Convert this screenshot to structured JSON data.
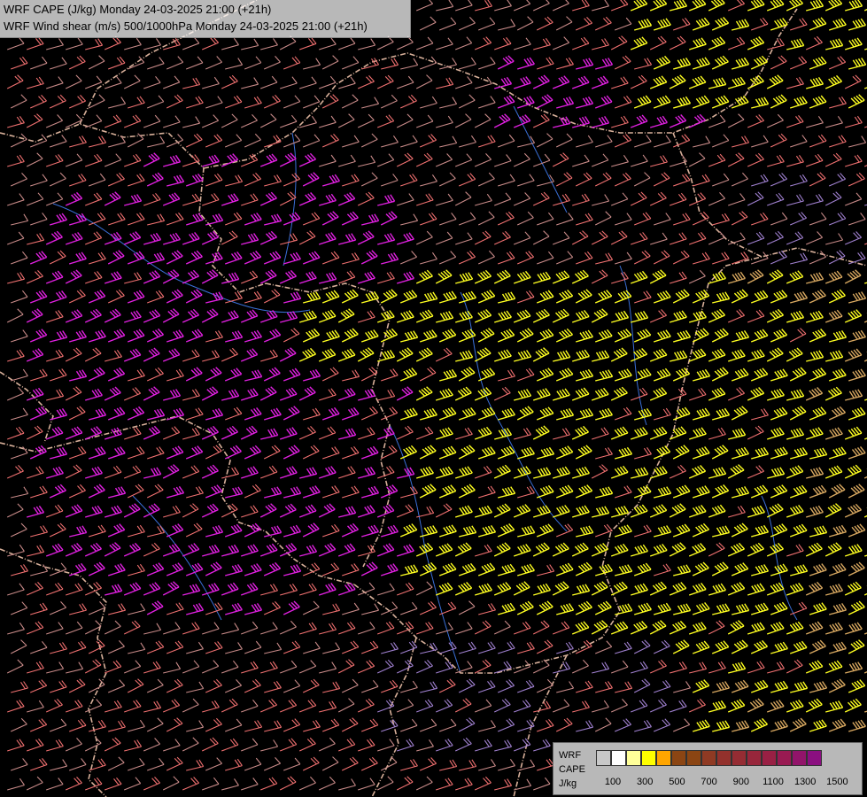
{
  "header": {
    "line1": "WRF CAPE (J/kg) Monday 24-03-2025 21:00 (+21h)",
    "line2": "WRF Wind shear (m/s) 500/1000hPa Monday 24-03-2025 21:00 (+21h)"
  },
  "legend": {
    "label_model": "WRF",
    "label_var": "CAPE",
    "label_unit": "J/kg",
    "swatch_colors": [
      "#c8c8c8",
      "#ffffff",
      "#ffff99",
      "#ffff00",
      "#ffa500",
      "#8b4513",
      "#8b4513",
      "#8f3a23",
      "#93312c",
      "#952c33",
      "#98263b",
      "#992044",
      "#991a52",
      "#92146a",
      "#8b0f80"
    ],
    "ticks": [
      "100",
      "300",
      "500",
      "700",
      "900",
      "1100",
      "1300",
      "1500"
    ]
  },
  "map_colors": {
    "background": "#000000",
    "borders": "#d8b09a",
    "rivers": "#3a6fd8",
    "barb_weak": "#c88a88",
    "barb_moderate": "#f07070",
    "barb_strong": "#e020e0",
    "barb_very_strong": "#ffff20",
    "barb_tan": "#d8a860",
    "barb_lavender": "#a080d0"
  }
}
